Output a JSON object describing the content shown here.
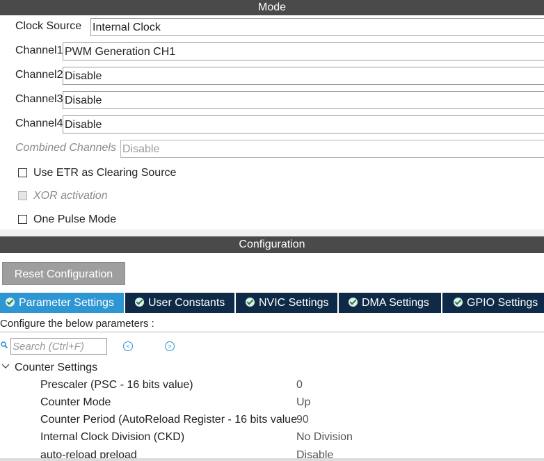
{
  "mode": {
    "title": "Mode",
    "clock_source": {
      "label": "Clock Source",
      "value": "Internal Clock"
    },
    "channels": [
      {
        "label": "Channel1",
        "value": "PWM Generation CH1"
      },
      {
        "label": "Channel2",
        "value": "Disable"
      },
      {
        "label": "Channel3",
        "value": "Disable"
      },
      {
        "label": "Channel4",
        "value": "Disable"
      }
    ],
    "combined": {
      "label": "Combined Channels",
      "value": "Disable"
    },
    "checkboxes": [
      {
        "label": "Use ETR as Clearing Source",
        "checked": false,
        "enabled": true
      },
      {
        "label": "XOR activation",
        "checked": false,
        "enabled": false
      },
      {
        "label": "One Pulse Mode",
        "checked": false,
        "enabled": true
      }
    ]
  },
  "config": {
    "title": "Configuration",
    "reset_label": "Reset Configuration",
    "tabs": [
      {
        "label": "Parameter Settings",
        "active": true
      },
      {
        "label": "User Constants",
        "active": false
      },
      {
        "label": "NVIC Settings",
        "active": false
      },
      {
        "label": "DMA Settings",
        "active": false
      },
      {
        "label": "GPIO Settings",
        "active": false
      }
    ],
    "hint": "Configure the below parameters :",
    "search": {
      "placeholder": "Search (Ctrl+F)"
    },
    "group": "Counter Settings",
    "params": [
      {
        "name": "Prescaler (PSC - 16 bits value)",
        "value": "0"
      },
      {
        "name": "Counter Mode",
        "value": "Up"
      },
      {
        "name": "Counter Period (AutoReload Register - 16 bits value",
        "value": "90"
      },
      {
        "name": "Internal Clock Division (CKD)",
        "value": "No Division"
      },
      {
        "name": "auto-reload preload",
        "value": "Disable"
      }
    ]
  },
  "colors": {
    "header": "#4a4a4a",
    "tab_bg": "#0e2a47",
    "tab_active": "#2d96d3",
    "button": "#9e9e9e"
  },
  "icons": [
    "check-circle-icon",
    "search-icon",
    "chevron-left-icon",
    "chevron-right-icon",
    "chevron-down-icon"
  ]
}
